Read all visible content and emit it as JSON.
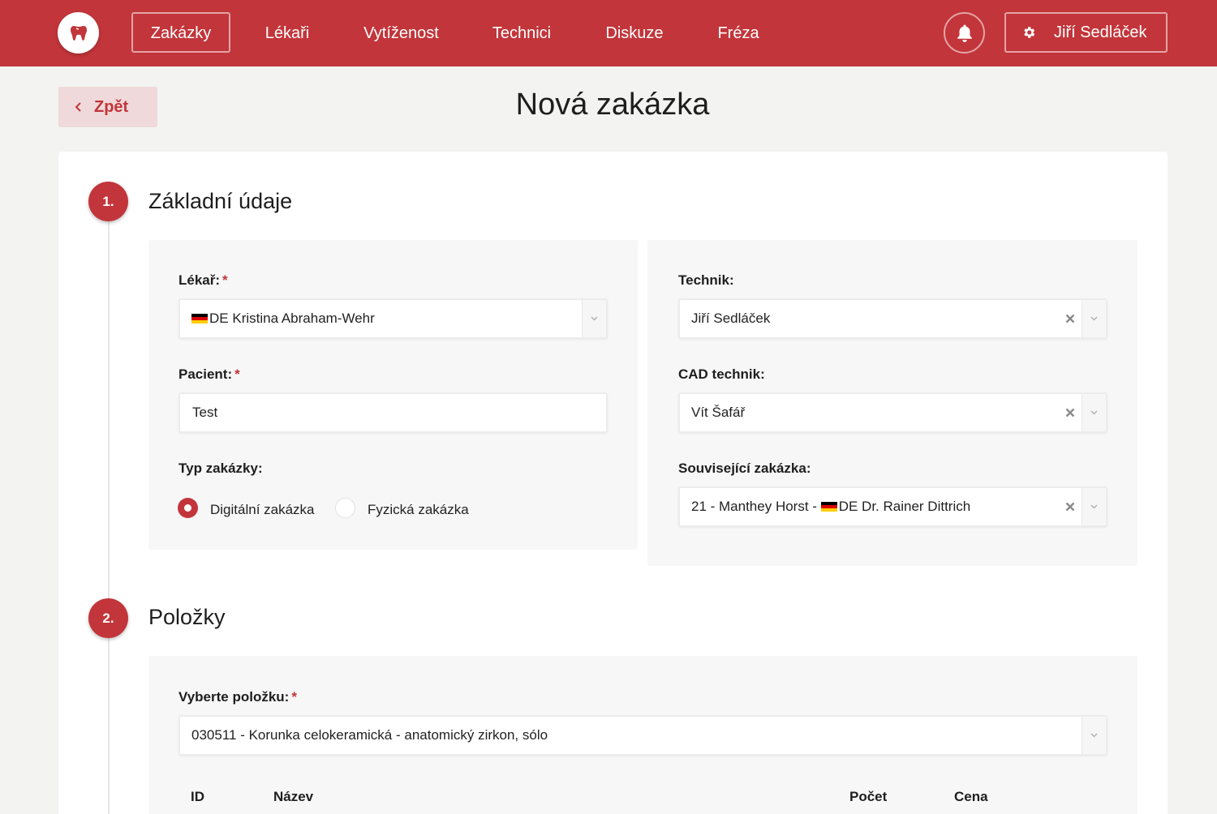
{
  "nav": {
    "items": [
      {
        "label": "Zakázky",
        "active": true
      },
      {
        "label": "Lékaři"
      },
      {
        "label": "Vytíženost"
      },
      {
        "label": "Technici"
      },
      {
        "label": "Diskuze"
      },
      {
        "label": "Fréza"
      }
    ],
    "user_name": "Jiří Sedláček"
  },
  "page": {
    "back_label": "Zpět",
    "title": "Nová zakázka"
  },
  "section1": {
    "number": "1.",
    "title": "Základní údaje",
    "doctor": {
      "label": "Lékař:",
      "required": "*",
      "country": "DE",
      "name": "Kristina Abraham-Wehr"
    },
    "patient": {
      "label": "Pacient:",
      "required": "*",
      "value": "Test"
    },
    "order_type": {
      "label": "Typ zakázky:",
      "options": [
        "Digitální zakázka",
        "Fyzická zakázka"
      ],
      "selected": "Digitální zakázka"
    },
    "technician": {
      "label": "Technik:",
      "value": "Jiří Sedláček"
    },
    "cad_technician": {
      "label": "CAD technik:",
      "value": "Vít Šafář"
    },
    "related_order": {
      "label": "Související zakázka:",
      "prefix": "21 - Manthey Horst -",
      "country": "DE",
      "name": "Dr. Rainer Dittrich"
    }
  },
  "section2": {
    "number": "2.",
    "title": "Položky",
    "item_select": {
      "label": "Vyberte položku:",
      "required": "*",
      "value": "030511 - Korunka celokeramická - anatomický zirkon, sólo"
    },
    "table_headers": {
      "id": "ID",
      "name": "Název",
      "count": "Počet",
      "price": "Cena"
    }
  },
  "colors": {
    "brand": "#c2353a",
    "background": "#f3f3f2",
    "panel": "#f7f7f7"
  },
  "icons": {
    "logo": "tooth-icon",
    "bell": "bell-icon",
    "settings": "gear-icon",
    "back": "chevron-left-icon",
    "dropdown": "chevron-down-icon",
    "clear": "close-icon",
    "flag": "germany-flag-icon"
  }
}
